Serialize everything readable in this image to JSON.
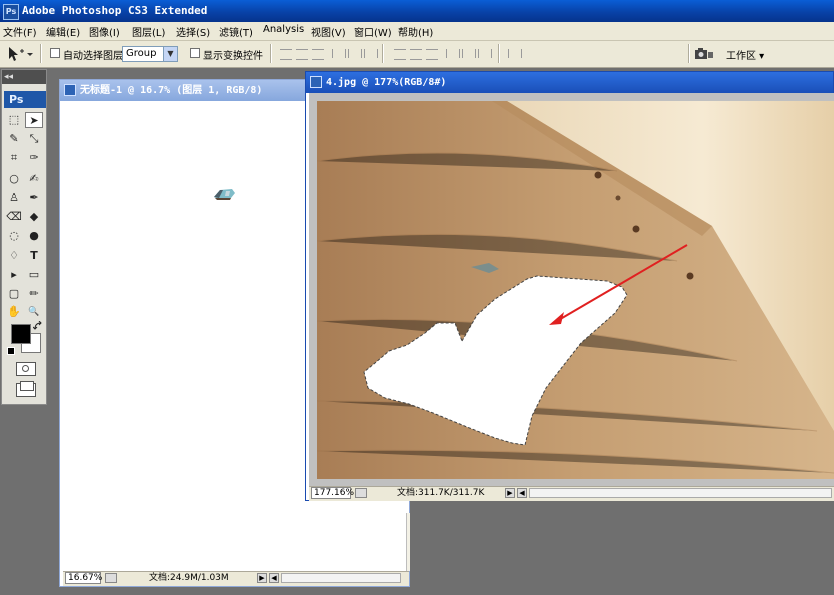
{
  "app": {
    "title": "Adobe Photoshop CS3 Extended",
    "logo": "Ps"
  },
  "menu": [
    "文件(F)",
    "编辑(E)",
    "图像(I)",
    "图层(L)",
    "选择(S)",
    "滤镜(T)",
    "Analysis",
    "视图(V)",
    "窗口(W)",
    "帮助(H)"
  ],
  "options": {
    "auto_select_label": "自动选择图层",
    "group_value": "Group",
    "show_transform_label": "显示变换控件",
    "workspace_label": "工作区 ▾"
  },
  "toolbox": {
    "collapse_glyph": "◂◂",
    "tools": [
      "⬚",
      "➤",
      "✎",
      "⤡",
      "⌗",
      "✑",
      "○",
      "✍",
      "♙",
      "✒",
      "⌫",
      "◆",
      "◌",
      "●",
      "♢",
      "T",
      "▸",
      "▭",
      "▢",
      "✏",
      "✋",
      "🔍"
    ]
  },
  "doc1": {
    "title": "无标题-1 @ 16.7% (图层 1, RGB/8)",
    "zoom": "16.67%",
    "info": "文档:24.9M/1.03M"
  },
  "doc2": {
    "title": "4.jpg @ 177%(RGB/8#)",
    "zoom": "177.16%",
    "info": "文档:311.7K/311.7K"
  },
  "colors": {
    "titlebar": "#0842a8",
    "active_doc_title": "#1f5fd0",
    "inactive_doc_title": "#8fb0e2",
    "wood": "#c39c6e",
    "arrow": "#e02020"
  }
}
